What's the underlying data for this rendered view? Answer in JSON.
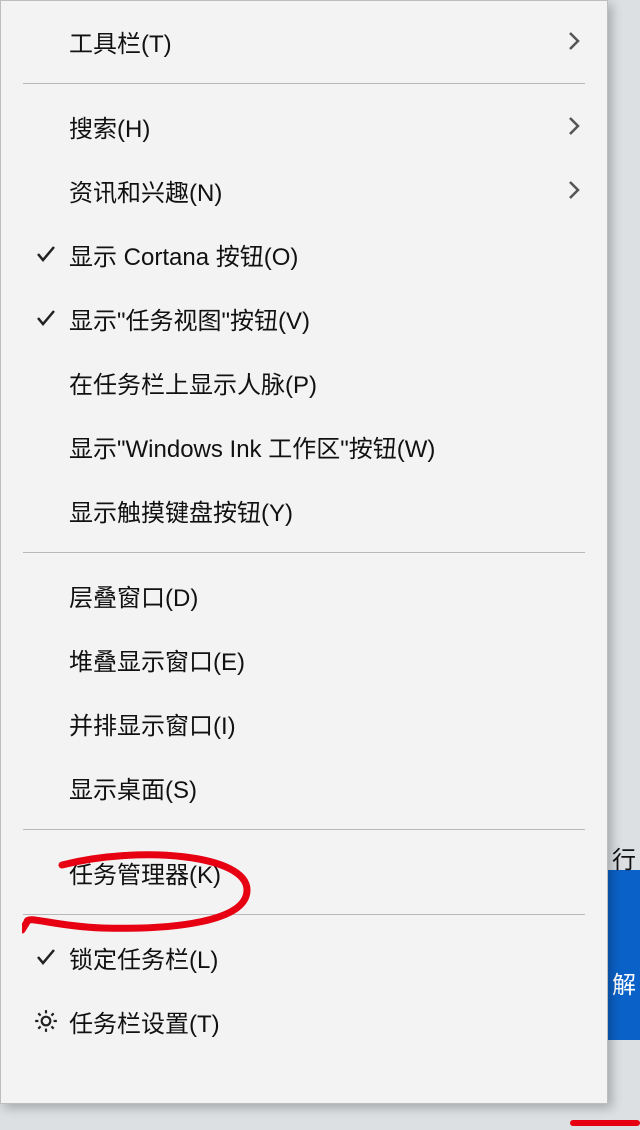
{
  "menu": {
    "groups": [
      [
        {
          "id": "toolbars",
          "label": "工具栏(T)",
          "submenu": true
        }
      ],
      [
        {
          "id": "search",
          "label": "搜索(H)",
          "submenu": true
        },
        {
          "id": "news",
          "label": "资讯和兴趣(N)",
          "submenu": true
        },
        {
          "id": "cortana",
          "label": "显示 Cortana 按钮(O)",
          "checked": true
        },
        {
          "id": "taskview",
          "label": "显示\"任务视图\"按钮(V)",
          "checked": true
        },
        {
          "id": "people",
          "label": "在任务栏上显示人脉(P)"
        },
        {
          "id": "ink",
          "label": "显示\"Windows Ink 工作区\"按钮(W)"
        },
        {
          "id": "touchkb",
          "label": "显示触摸键盘按钮(Y)"
        }
      ],
      [
        {
          "id": "cascade",
          "label": "层叠窗口(D)"
        },
        {
          "id": "stacked",
          "label": "堆叠显示窗口(E)"
        },
        {
          "id": "sidebyside",
          "label": "并排显示窗口(I)"
        },
        {
          "id": "desktop",
          "label": "显示桌面(S)"
        }
      ],
      [
        {
          "id": "taskmgr",
          "label": "任务管理器(K)",
          "highlighted": true
        }
      ],
      [
        {
          "id": "lock",
          "label": "锁定任务栏(L)",
          "checked": true
        },
        {
          "id": "settings",
          "label": "任务栏设置(T)",
          "icon": "gear"
        }
      ]
    ]
  },
  "bg": {
    "top_char": "行",
    "blue_char": "解"
  }
}
